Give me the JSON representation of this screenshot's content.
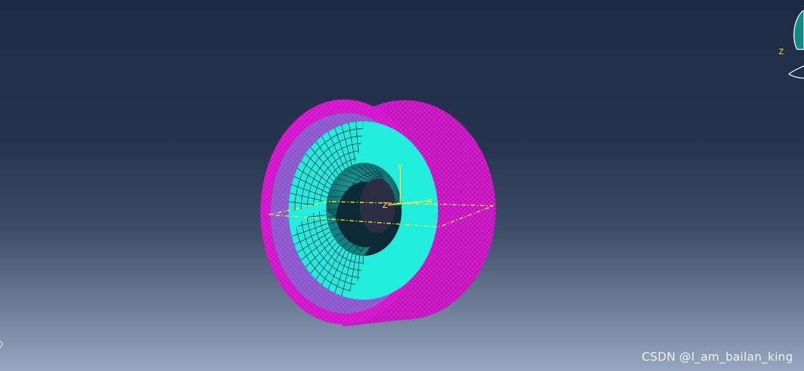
{
  "viewport": {
    "background_top": "#1e2a44",
    "background_bottom": "#98a6be"
  },
  "model": {
    "outer_shell_color": "#e01bd9",
    "shell_mesh_color": "#7a1578",
    "inner_ring_color": "#22ecdc",
    "ring_mesh_color": "#0b2d3a",
    "bore_color": "#14807e",
    "datum_color": "#ffee33"
  },
  "local_csys": {
    "x_label": "X",
    "y_label": "Y",
    "z_label": "Z"
  },
  "view_triad": {
    "z_label": "Z"
  },
  "watermark": {
    "text": "CSDN @I_am_bailan_king"
  }
}
